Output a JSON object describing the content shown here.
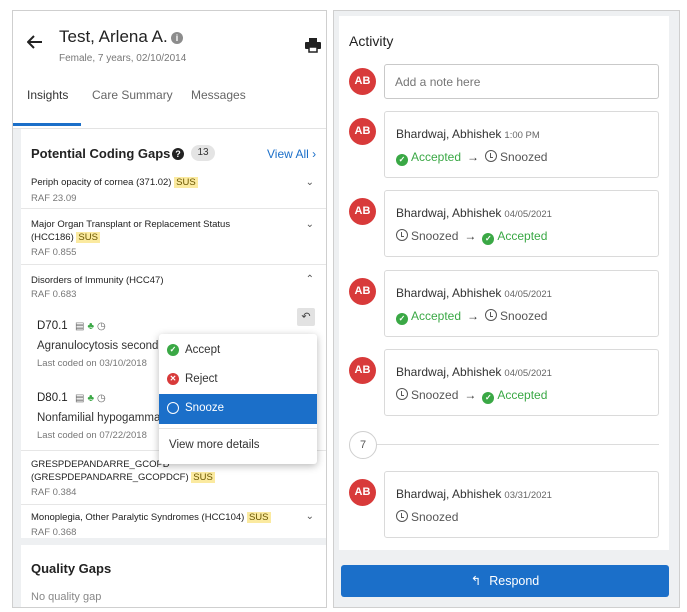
{
  "patient": {
    "name": "Test, Arlena A.",
    "info_icon": "i",
    "subtitle": "Female, 7 years, 02/10/2014"
  },
  "tabs": [
    "Insights",
    "Care Summary",
    "Messages"
  ],
  "coding_gaps": {
    "title": "Potential Coding Gaps",
    "help": "?",
    "count": "13",
    "view_all": "View All",
    "rows": [
      {
        "title": "Periph opacity of cornea (371.02)",
        "badge": "SUS",
        "raf": "RAF 23.09"
      },
      {
        "title": "Major Organ Transplant or Replacement Status",
        "title2": "(HCC186)",
        "badge": "SUS",
        "raf": "RAF 0.855"
      },
      {
        "title": "Disorders of Immunity (HCC47)",
        "raf": "RAF 0.683"
      },
      {
        "title": "GRESPDEPANDARRE_GCOPD",
        "title2": "(GRESPDEPANDARRE_GCOPDCF)",
        "badge": "SUS",
        "raf": "RAF 0.384"
      },
      {
        "title": "Monoplegia, Other Paralytic Syndromes (HCC104)",
        "badge": "SUS",
        "raf": "RAF 0.368"
      }
    ],
    "codes": [
      {
        "code": "D70.1",
        "desc": "Agranulocytosis seconda",
        "last": "Last coded on 03/10/2018"
      },
      {
        "code": "D80.1",
        "desc": "Nonfamilial hypogammag",
        "last": "Last coded on 07/22/2018"
      }
    ]
  },
  "quality_gaps": {
    "title": "Quality Gaps",
    "empty": "No quality gap"
  },
  "menu": {
    "accept": "Accept",
    "reject": "Reject",
    "snooze": "Snooze",
    "more": "View more details"
  },
  "activity": {
    "title": "Activity",
    "avatar": "AB",
    "note_placeholder": "Add a note here",
    "entries": [
      {
        "name": "Bhardwaj, Abhishek",
        "date": "1:00 PM",
        "from": "Accepted",
        "to": "Snoozed"
      },
      {
        "name": "Bhardwaj, Abhishek",
        "date": "04/05/2021",
        "from": "Snoozed",
        "to": "Accepted"
      },
      {
        "name": "Bhardwaj, Abhishek",
        "date": "04/05/2021",
        "from": "Accepted",
        "to": "Snoozed"
      },
      {
        "name": "Bhardwaj, Abhishek",
        "date": "04/05/2021",
        "from": "Snoozed",
        "to": "Accepted"
      },
      {
        "name": "Bhardwaj, Abhishek",
        "date": "03/31/2021",
        "status": "Snoozed"
      }
    ],
    "separator": "7",
    "arrow": "→"
  },
  "respond_label": "Respond",
  "colors": {
    "accent": "#1b6fc9",
    "avatar": "#d83a3a",
    "accepted": "#3aa845",
    "badge": "#fbeaa0"
  }
}
